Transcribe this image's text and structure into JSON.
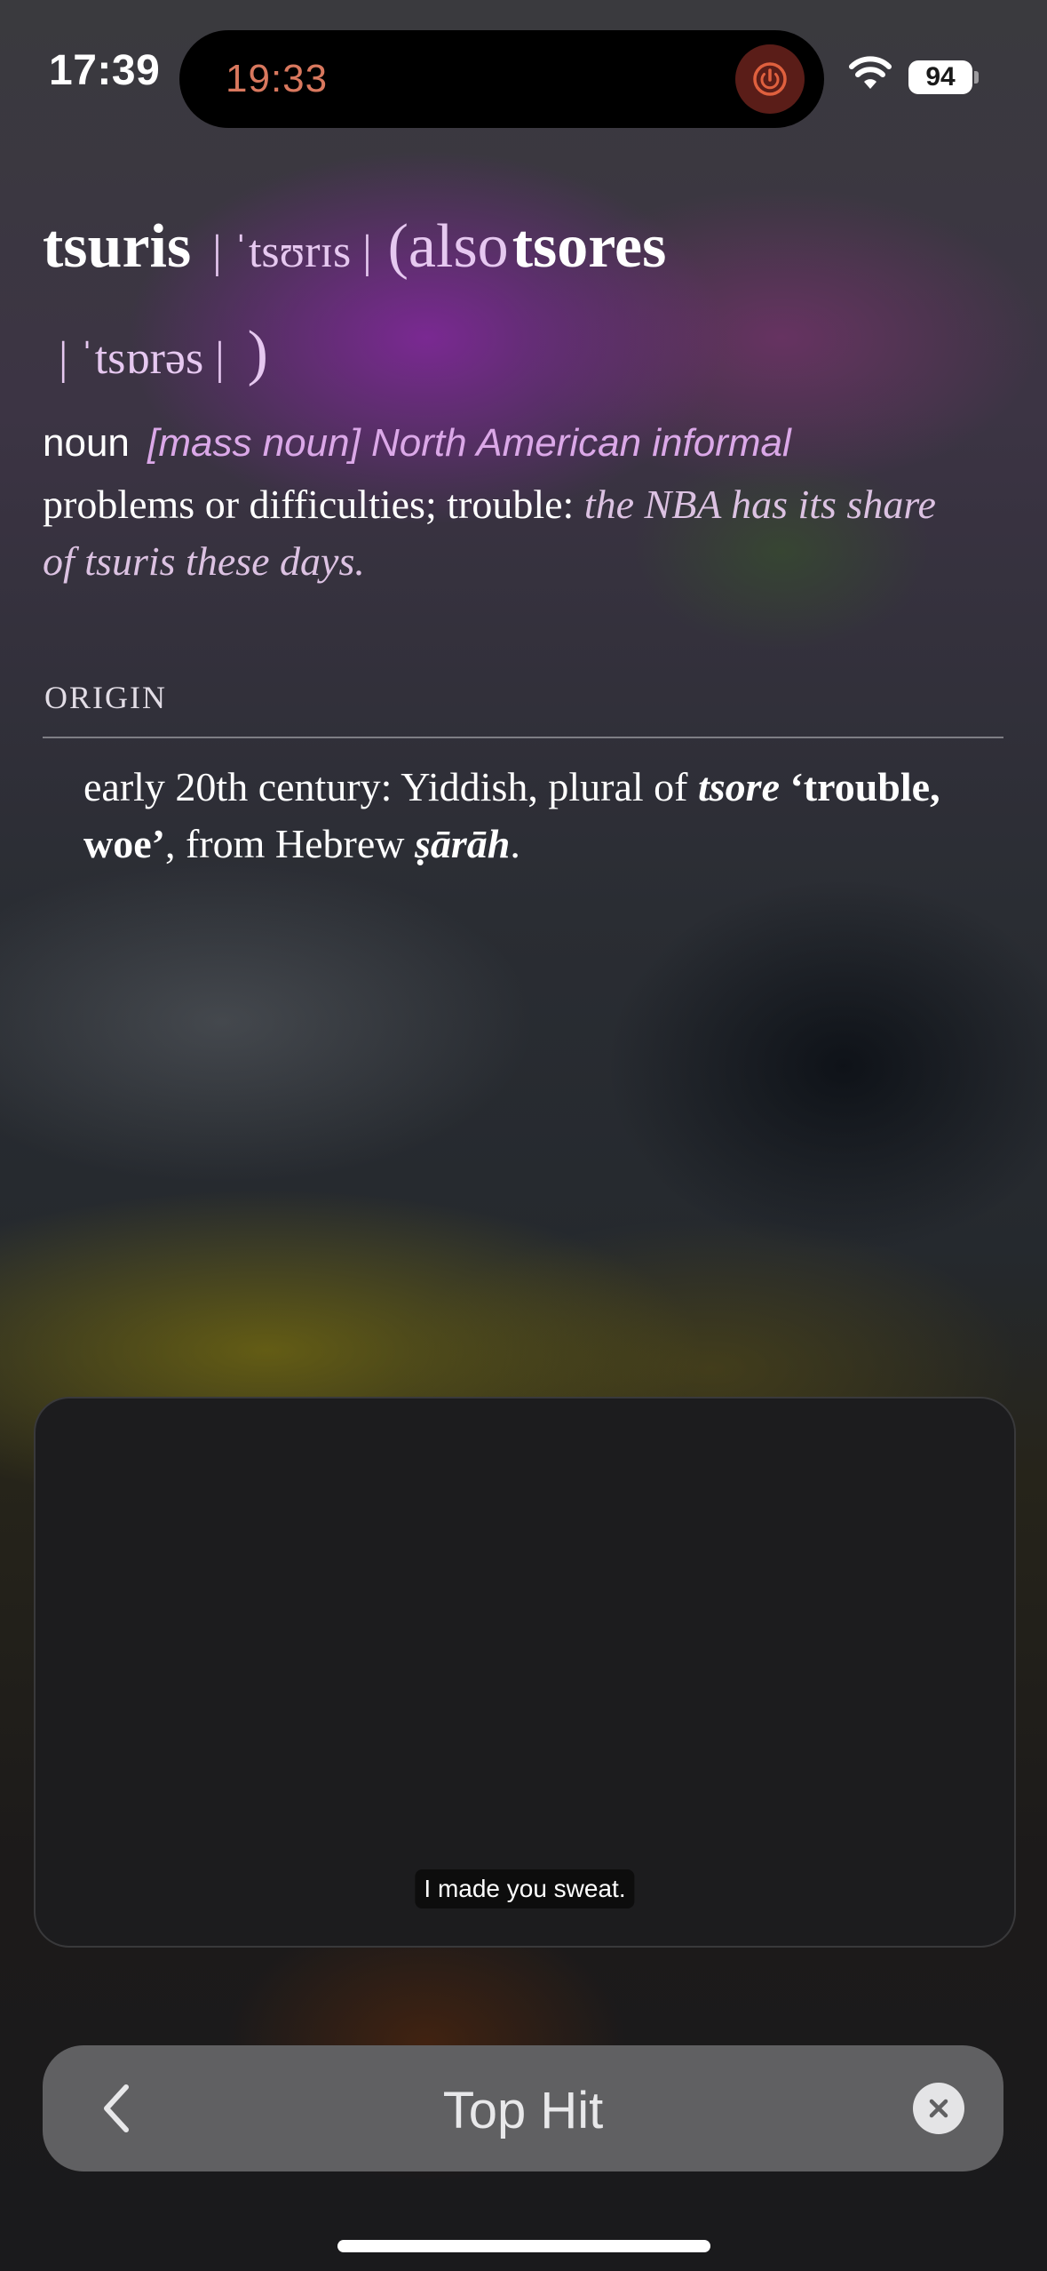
{
  "status_bar": {
    "time": "17:39",
    "timer": "19:33",
    "battery": "94",
    "icons": [
      "power-icon",
      "wifi-icon",
      "battery-icon"
    ]
  },
  "entry": {
    "headword": "tsuris",
    "pronunciation": "| ˈtsʊrɪs |",
    "also_open": "(also",
    "variant": "tsores",
    "variant_pronunciation": "| ˈtsɒrəs |",
    "close_paren": ")",
    "part_of_speech": "noun",
    "labels": "[mass noun] North American informal",
    "definition": "problems or difficulties; trouble:",
    "example": "the NBA has its share of tsuris these days."
  },
  "origin": {
    "heading": "ORIGIN",
    "part1": "early 20th century: Yiddish, plural of",
    "word1": "tsore",
    "gloss": "‘trouble, woe’",
    "part2": ", from Hebrew",
    "word2": "ṣārāh",
    "end": "."
  },
  "video": {
    "caption": "I made you sweat."
  },
  "search": {
    "title": "Top Hit",
    "back_icon": "chevron-left-icon",
    "clear_icon": "clear-icon"
  },
  "colors": {
    "timer": "#d9785e",
    "pronunciation": "#e6c8f0",
    "labels": "#dba8e8",
    "card": "#1c1c1e",
    "search_bar": "#606062"
  }
}
